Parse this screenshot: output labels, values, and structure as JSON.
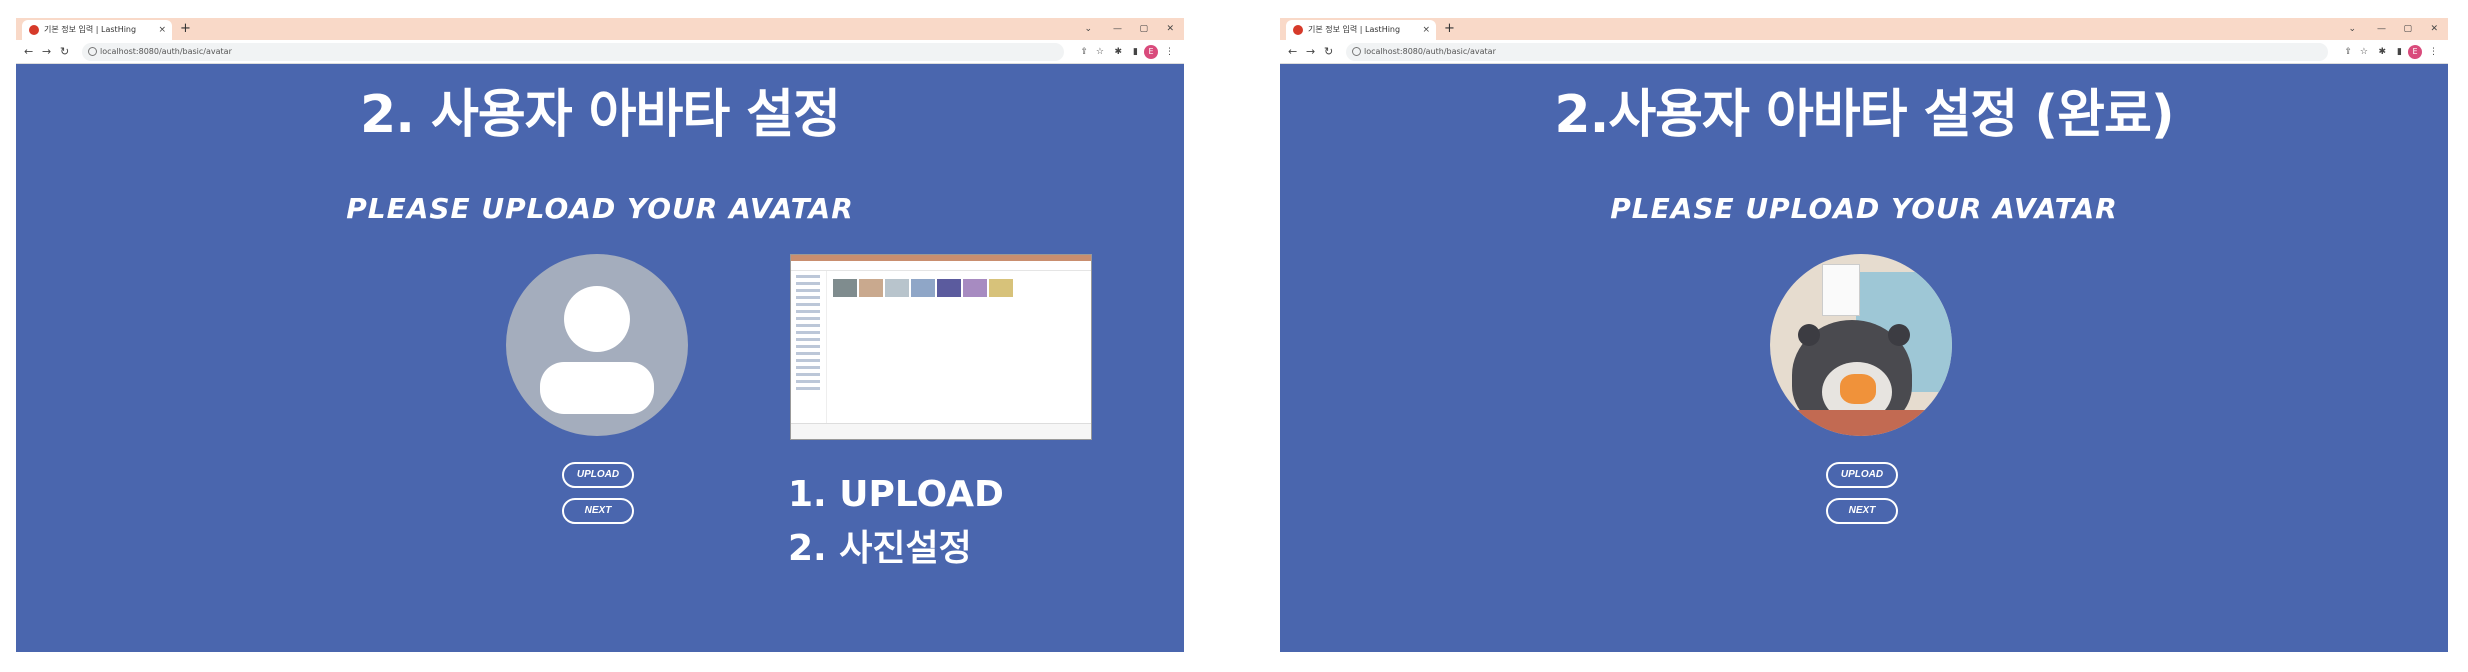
{
  "screens": [
    {
      "tab_title": "기본 정보 입력 | LastHing",
      "url": "localhost:8080/auth/basic/avatar",
      "heading": "2. 사용자 아바타 설정",
      "subheading": "PLEASE UPLOAD YOUR AVATAR",
      "upload_label": "UPLOAD",
      "next_label": "NEXT",
      "steps": [
        "1.   UPLOAD",
        "2.  사진설정"
      ]
    },
    {
      "tab_title": "기본 정보 입력 | LastHing",
      "url": "localhost:8080/auth/basic/avatar",
      "heading": "2.사용자 아바타 설정 (완료)",
      "subheading": "PLEASE UPLOAD YOUR AVATAR",
      "upload_label": "UPLOAD",
      "next_label": "NEXT"
    }
  ],
  "browser": {
    "new_tab": "+",
    "close_tab": "×",
    "minimize": "—",
    "maximize": "▢",
    "close": "✕",
    "chevron": "⌄",
    "profile_initial": "E",
    "icons": [
      "back-icon",
      "forward-icon",
      "reload-icon",
      "info-icon",
      "share-icon",
      "star-icon",
      "extensions-icon",
      "sidepanel-icon",
      "menu-icon"
    ]
  },
  "colors": {
    "page_background": "#4a66ae",
    "tab_strip": "#f9d9c8",
    "placeholder_avatar": "#a4adbd"
  }
}
